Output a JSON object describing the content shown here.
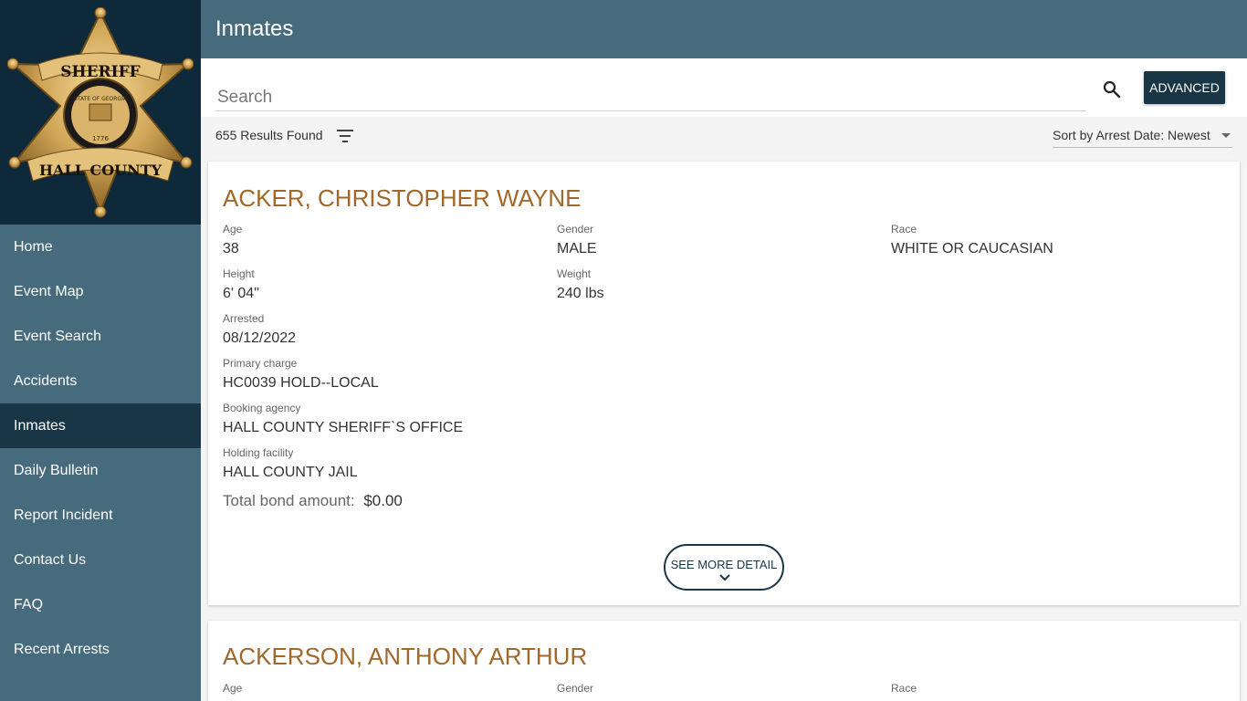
{
  "logo": {
    "top_text": "SHERIFF",
    "bottom_text": "HALL COUNTY",
    "seal_text": "STATE OF GEORGIA",
    "year": "1776"
  },
  "sidebar": {
    "items": [
      {
        "label": "Home"
      },
      {
        "label": "Event Map"
      },
      {
        "label": "Event Search"
      },
      {
        "label": "Accidents"
      },
      {
        "label": "Inmates"
      },
      {
        "label": "Daily Bulletin"
      },
      {
        "label": "Report Incident"
      },
      {
        "label": "Contact Us"
      },
      {
        "label": "FAQ"
      },
      {
        "label": "Recent Arrests"
      }
    ],
    "active": "Inmates"
  },
  "header": {
    "title": "Inmates"
  },
  "search": {
    "placeholder": "Search",
    "advanced_label": "ADVANCED"
  },
  "results": {
    "count_text": "655 Results Found",
    "sort_label": "Sort by Arrest Date: Newest"
  },
  "inmates": [
    {
      "name": "ACKER, CHRISTOPHER WAYNE",
      "age_label": "Age",
      "age": "38",
      "gender_label": "Gender",
      "gender": "MALE",
      "race_label": "Race",
      "race": "WHITE OR CAUCASIAN",
      "height_label": "Height",
      "height": "6' 04\"",
      "weight_label": "Weight",
      "weight": "240 lbs",
      "arrested_label": "Arrested",
      "arrested": "08/12/2022",
      "charge_label": "Primary charge",
      "charge": "HC0039 HOLD--LOCAL",
      "agency_label": "Booking agency",
      "agency": "HALL COUNTY SHERIFF`S OFFICE",
      "facility_label": "Holding facility",
      "facility": "HALL COUNTY JAIL",
      "bond_label": "Total bond amount:",
      "bond": "$0.00",
      "more_label": "SEE MORE DETAIL"
    },
    {
      "name": "ACKERSON, ANTHONY ARTHUR",
      "age_label": "Age",
      "gender_label": "Gender",
      "race_label": "Race"
    }
  ],
  "colors": {
    "sidebar_bg": "#466b7d",
    "sidebar_active": "#183646",
    "logo_bg": "#0e2a3a",
    "name_color": "#a0692b"
  }
}
